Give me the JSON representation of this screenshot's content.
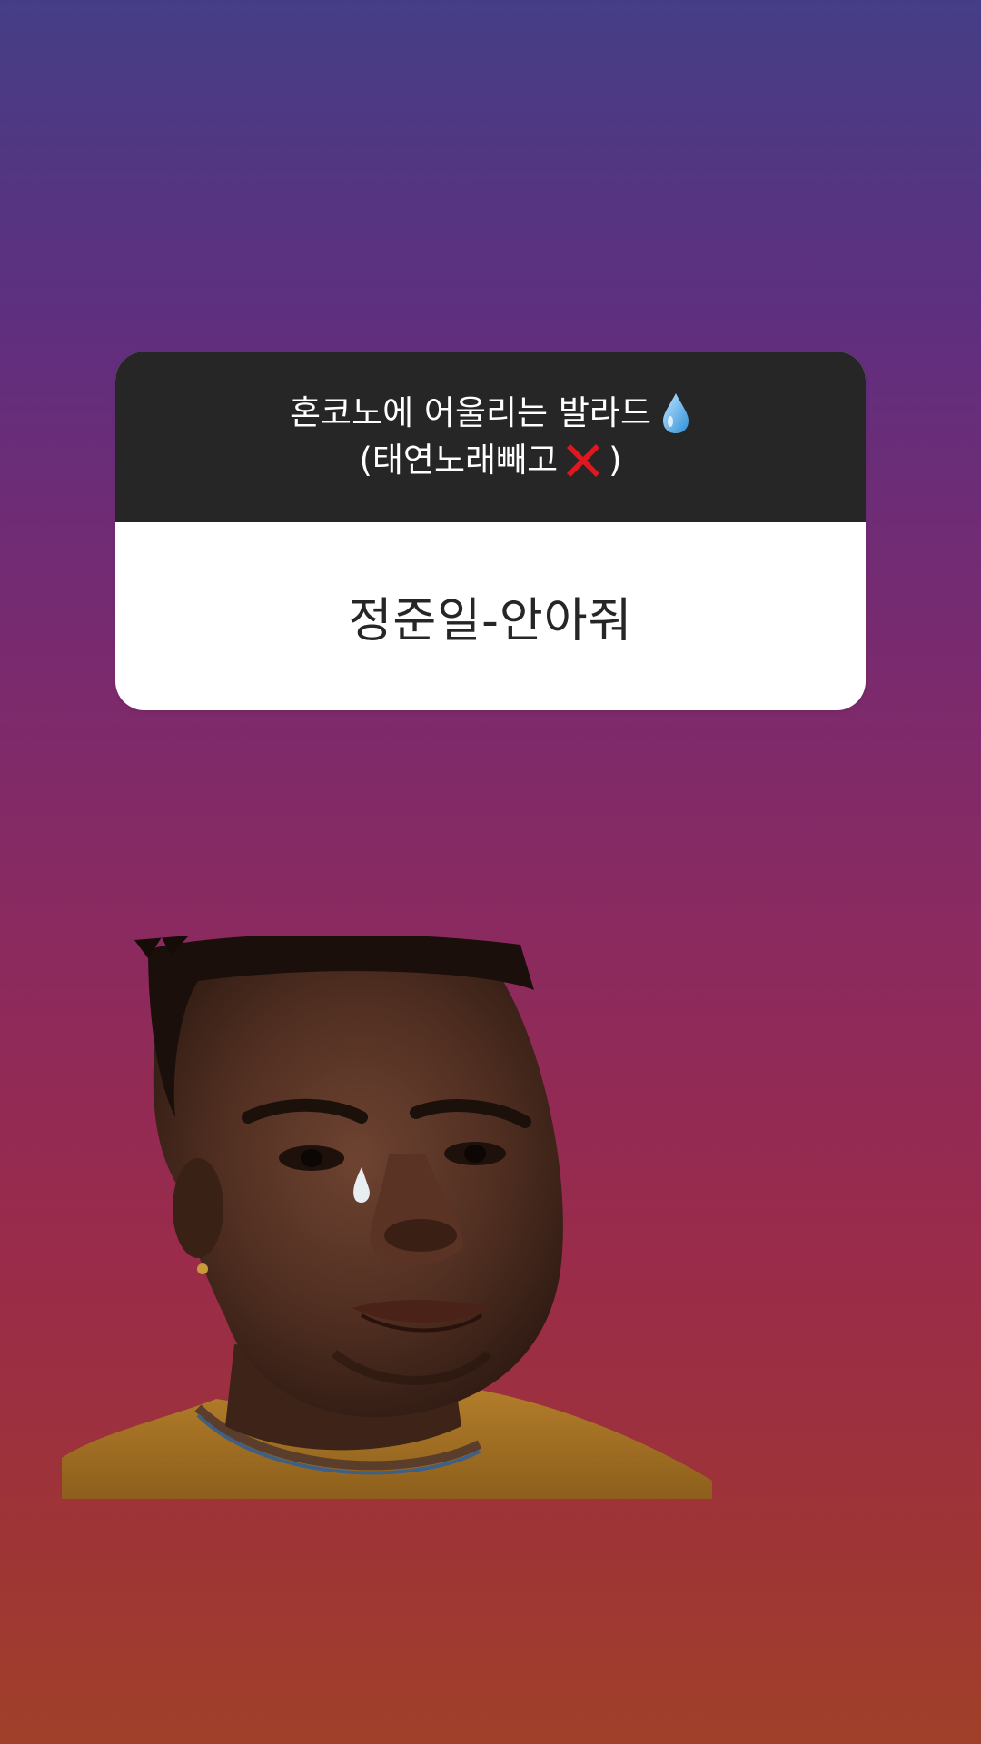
{
  "story": {
    "question": {
      "line1": "혼코노에 어울리는 발라드",
      "line2_prefix": "(태연노래빼고",
      "line2_suffix": ")",
      "icons": [
        "water-drop-icon",
        "red-cross-icon"
      ]
    },
    "answer": {
      "text": "정준일-안아줘"
    },
    "sticker": {
      "name": "crying-man-sticker"
    }
  },
  "colors": {
    "header_bg": "#262626",
    "answer_bg": "#ffffff",
    "answer_text": "#262626",
    "gradient_top": "#453e86",
    "gradient_bottom": "#a0402a"
  }
}
